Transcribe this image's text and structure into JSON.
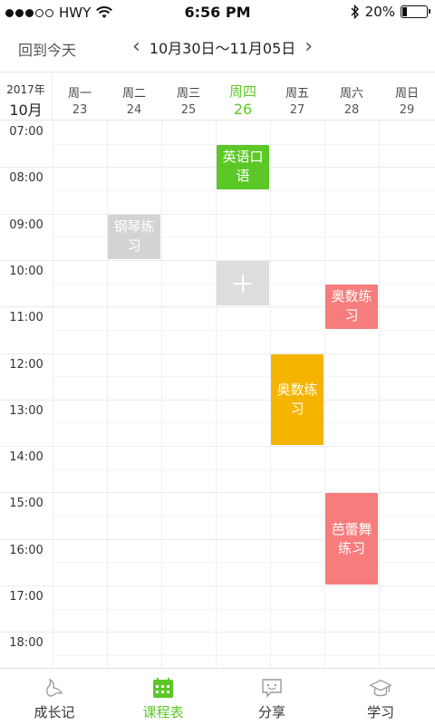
{
  "status_bar": {
    "carrier": "HWY",
    "time": "6:56 PM",
    "battery": "20%",
    "battery_level": 0.2,
    "signal_dots_filled": 3,
    "signal_dots_total": 5
  },
  "nav": {
    "today_button": "回到今天",
    "prev_icon": "chevron-left-icon",
    "next_icon": "chevron-right-icon",
    "week_range": "10月30日～11月05日"
  },
  "header": {
    "year": "2017年",
    "month": "10月",
    "days": [
      {
        "weekday": "周一",
        "date": "23",
        "today": false
      },
      {
        "weekday": "周二",
        "date": "24",
        "today": false
      },
      {
        "weekday": "周三",
        "date": "25",
        "today": false
      },
      {
        "weekday": "周四",
        "date": "26",
        "today": true
      },
      {
        "weekday": "周五",
        "date": "27",
        "today": false
      },
      {
        "weekday": "周六",
        "date": "28",
        "today": false
      },
      {
        "weekday": "周日",
        "date": "29",
        "today": false
      }
    ]
  },
  "times": [
    "07:00",
    "08:00",
    "09:00",
    "10:00",
    "11:00",
    "12:00",
    "13:00",
    "14:00",
    "15:00",
    "16:00",
    "17:00",
    "18:00"
  ],
  "events": [
    {
      "title": "英语口语",
      "day": 3,
      "start": "07:30",
      "end": "08:30",
      "color": "#5cc828"
    },
    {
      "title": "钢琴练习",
      "day": 1,
      "start": "09:00",
      "end": "10:00",
      "color": "#d3d3d3"
    },
    {
      "title": "奥数练习",
      "day": 5,
      "start": "10:30",
      "end": "11:30",
      "color": "#f77c7c"
    },
    {
      "title": "奥数练习",
      "day": 4,
      "start": "12:00",
      "end": "14:00",
      "color": "#f5b400"
    },
    {
      "title": "芭蕾舞练习",
      "day": 5,
      "start": "15:00",
      "end": "17:00",
      "color": "#f77c7c"
    }
  ],
  "add_slot": {
    "day": 3,
    "start": "10:00",
    "end": "11:00",
    "icon": "plus-icon"
  },
  "accent_color": "#5cc828",
  "tabs": [
    {
      "label": "成长记",
      "icon": "footprint-icon",
      "active": false
    },
    {
      "label": "课程表",
      "icon": "calendar-icon",
      "active": true
    },
    {
      "label": "分享",
      "icon": "chat-bubble-icon",
      "active": false
    },
    {
      "label": "学习",
      "icon": "graduation-cap-icon",
      "active": false
    }
  ]
}
